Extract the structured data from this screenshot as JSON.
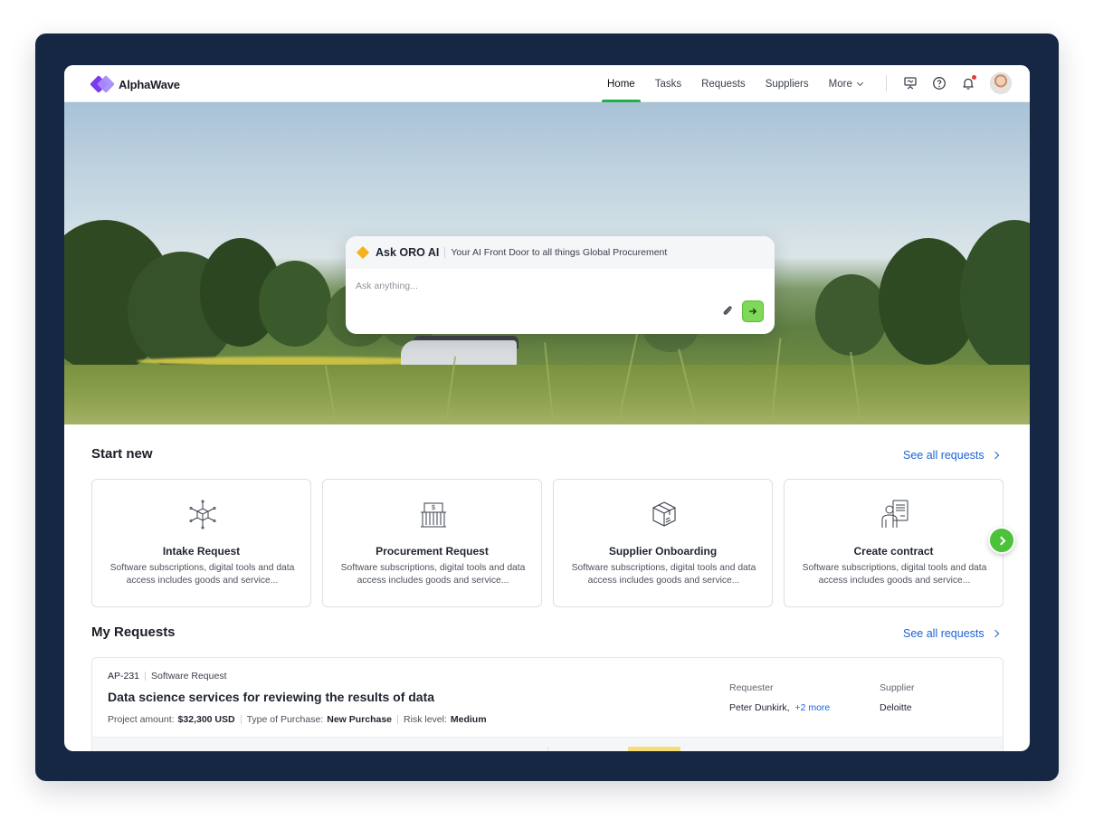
{
  "brand": {
    "name": "AlphaWave"
  },
  "nav": {
    "items": [
      {
        "label": "Home",
        "active": true
      },
      {
        "label": "Tasks",
        "active": false
      },
      {
        "label": "Requests",
        "active": false
      },
      {
        "label": "Suppliers",
        "active": false
      },
      {
        "label": "More",
        "active": false
      }
    ],
    "icons": [
      "presentation-icon",
      "help-icon",
      "bell-icon",
      "avatar"
    ]
  },
  "ask": {
    "title": "Ask ORO AI",
    "subtitle": "Your AI Front Door to all things Global Procurement",
    "placeholder": "Ask anything..."
  },
  "start_new": {
    "title": "Start new",
    "see_all": "See all requests",
    "cards": [
      {
        "title": "Intake Request",
        "description": "Software subscriptions, digital tools and data access includes goods and service...",
        "icon": "box-network-icon"
      },
      {
        "title": "Procurement Request",
        "description": "Software subscriptions, digital tools and data access includes goods and service...",
        "icon": "building-dollar-icon"
      },
      {
        "title": "Supplier Onboarding",
        "description": "Software subscriptions, digital tools and data access includes goods and service...",
        "icon": "package-icon"
      },
      {
        "title": "Create contract",
        "description": "Software subscriptions, digital tools and data access includes goods and service...",
        "icon": "person-contract-icon"
      }
    ]
  },
  "my_requests": {
    "title": "My Requests",
    "see_all": "See all requests",
    "items": [
      {
        "id": "AP-231",
        "type": "Software Request",
        "title": "Data science services for reviewing the results of data",
        "amount_label": "Project amount:",
        "amount": "$32,300 USD",
        "purchase_label": "Type of Purchase:",
        "purchase": "New Purchase",
        "risk_label": "Risk level:",
        "risk": "Medium",
        "requester_label": "Requester",
        "requester": "Peter Dunkirk,",
        "requester_more": "+2 more",
        "supplier_label": "Supplier",
        "supplier": "Deloitte"
      }
    ]
  },
  "colors": {
    "accent_green": "#22b04b",
    "link_blue": "#1a64d6",
    "frame": "#152742",
    "send_green": "#7ed957"
  }
}
